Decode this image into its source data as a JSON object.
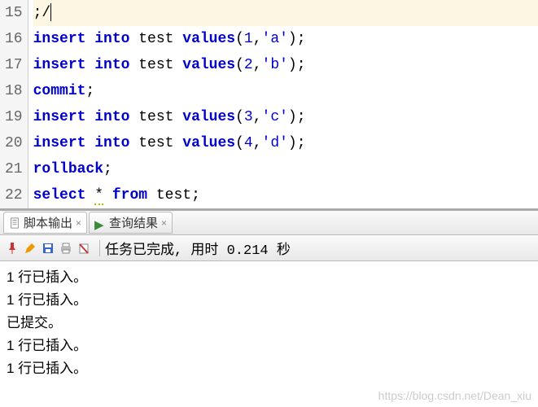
{
  "editor": {
    "lines": [
      {
        "num": "15"
      },
      {
        "num": "16"
      },
      {
        "num": "17"
      },
      {
        "num": "18"
      },
      {
        "num": "19"
      },
      {
        "num": "20"
      },
      {
        "num": "21"
      },
      {
        "num": "22"
      }
    ],
    "l15": ";/",
    "l16_kw1": "insert",
    "l16_kw2": "into",
    "l16_id": " test ",
    "l16_kw3": "values",
    "l16_p1": "(",
    "l16_n": "1",
    "l16_c": ",",
    "l16_s": "'a'",
    "l16_p2": ");",
    "l17_kw1": "insert",
    "l17_kw2": "into",
    "l17_id": " test ",
    "l17_kw3": "values",
    "l17_p1": "(",
    "l17_n": "2",
    "l17_c": ",",
    "l17_s": "'b'",
    "l17_p2": ");",
    "l18_kw": "commit",
    "l18_p": ";",
    "l19_kw1": "insert",
    "l19_kw2": "into",
    "l19_id": " test ",
    "l19_kw3": "values",
    "l19_p1": "(",
    "l19_n": "3",
    "l19_c": ",",
    "l19_s": "'c'",
    "l19_p2": ");",
    "l20_kw1": "insert",
    "l20_kw2": "into",
    "l20_id": " test ",
    "l20_kw3": "values",
    "l20_p1": "(",
    "l20_n": "4",
    "l20_c": ",",
    "l20_s": "'d'",
    "l20_p2": ");",
    "l21_kw": "rollback",
    "l21_p": ";",
    "l22_kw1": "select",
    "l22_star": "*",
    "l22_kw2": "from",
    "l22_id": " test",
    "l22_p": ";"
  },
  "tabs": {
    "script_output": "脚本输出",
    "query_result": "查询结果"
  },
  "toolbar": {
    "status": "任务已完成, 用时 0.214 秒"
  },
  "output": {
    "l1": "1 行已插入。",
    "l2": "1 行已插入。",
    "l3": "已提交。",
    "l4": "1 行已插入。",
    "l5": "1 行已插入。"
  },
  "watermark": "https://blog.csdn.net/Dean_xiu"
}
